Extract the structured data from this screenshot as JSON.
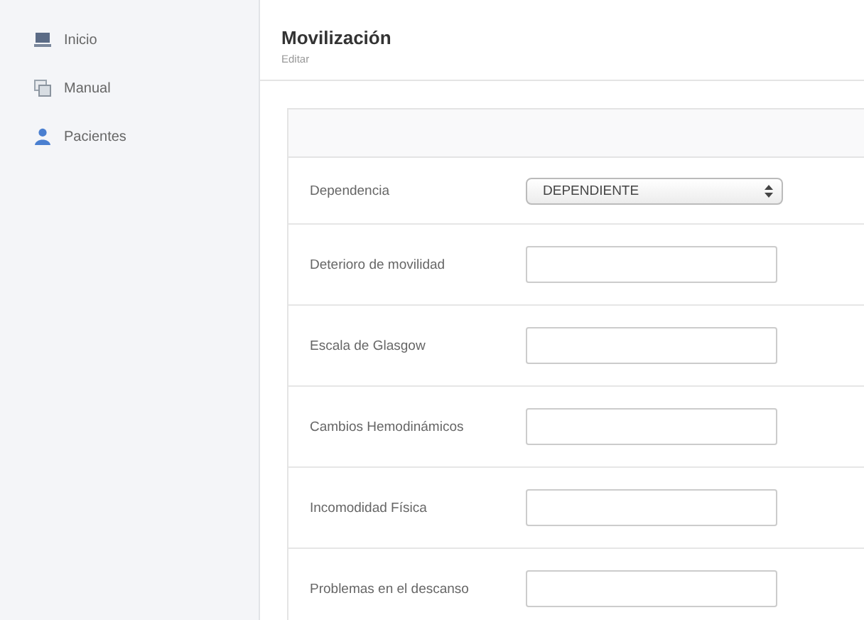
{
  "sidebar": {
    "items": [
      {
        "label": "Inicio",
        "kind": "home"
      },
      {
        "label": "Manual",
        "kind": "manual"
      },
      {
        "label": "Pacientes",
        "kind": "patients"
      }
    ]
  },
  "header": {
    "title": "Movilización",
    "subtitle": "Editar"
  },
  "form": {
    "fields": [
      {
        "kind": "select",
        "label": "Dependencia",
        "value": "DEPENDIENTE"
      },
      {
        "kind": "text",
        "label": "Deterioro de movilidad"
      },
      {
        "kind": "text",
        "label": "Escala de Glasgow"
      },
      {
        "kind": "text",
        "label": "Cambios Hemodinámicos"
      },
      {
        "kind": "text",
        "label": "Incomodidad Física"
      },
      {
        "kind": "text",
        "label": "Problemas en el descanso"
      }
    ]
  }
}
